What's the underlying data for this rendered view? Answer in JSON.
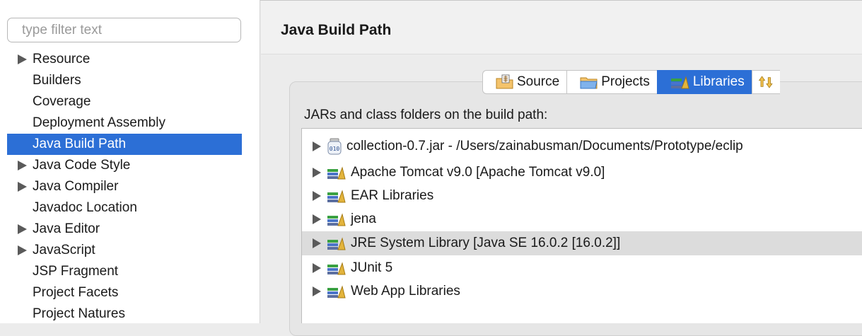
{
  "filter": {
    "placeholder": "type filter text",
    "value": ""
  },
  "sidebar": {
    "items": [
      {
        "label": "Resource",
        "expandable": true
      },
      {
        "label": "Builders",
        "expandable": false
      },
      {
        "label": "Coverage",
        "expandable": false
      },
      {
        "label": "Deployment Assembly",
        "expandable": false
      },
      {
        "label": "Java Build Path",
        "expandable": false,
        "selected": true
      },
      {
        "label": "Java Code Style",
        "expandable": true
      },
      {
        "label": "Java Compiler",
        "expandable": true
      },
      {
        "label": "Javadoc Location",
        "expandable": false
      },
      {
        "label": "Java Editor",
        "expandable": true
      },
      {
        "label": "JavaScript",
        "expandable": true
      },
      {
        "label": "JSP Fragment",
        "expandable": false
      },
      {
        "label": "Project Facets",
        "expandable": false
      },
      {
        "label": "Project Natures",
        "expandable": false
      }
    ]
  },
  "page": {
    "title": "Java Build Path"
  },
  "tabs": [
    {
      "label": "Source",
      "icon": "source-folder-icon"
    },
    {
      "label": "Projects",
      "icon": "projects-folder-icon"
    },
    {
      "label": "Libraries",
      "icon": "library-icon",
      "active": true
    },
    {
      "label": "",
      "icon": "order-export-icon"
    }
  ],
  "libraries": {
    "section_label": "JARs and class folders on the build path:",
    "entries": [
      {
        "label": "collection-0.7.jar - /Users/zainabusman/Documents/Prototype/eclip",
        "icon": "jar-icon"
      },
      {
        "label": "Apache Tomcat v9.0 [Apache Tomcat v9.0]",
        "icon": "library-icon"
      },
      {
        "label": "EAR Libraries",
        "icon": "library-icon"
      },
      {
        "label": "jena",
        "icon": "library-icon"
      },
      {
        "label": "JRE System Library [Java SE 16.0.2 [16.0.2]]",
        "icon": "library-icon",
        "selected": true
      },
      {
        "label": "JUnit 5",
        "icon": "library-icon"
      },
      {
        "label": "Web App Libraries",
        "icon": "library-icon"
      }
    ]
  },
  "colors": {
    "selection_blue": "#2c6fd6",
    "row_highlight": "#dcdcdc"
  }
}
